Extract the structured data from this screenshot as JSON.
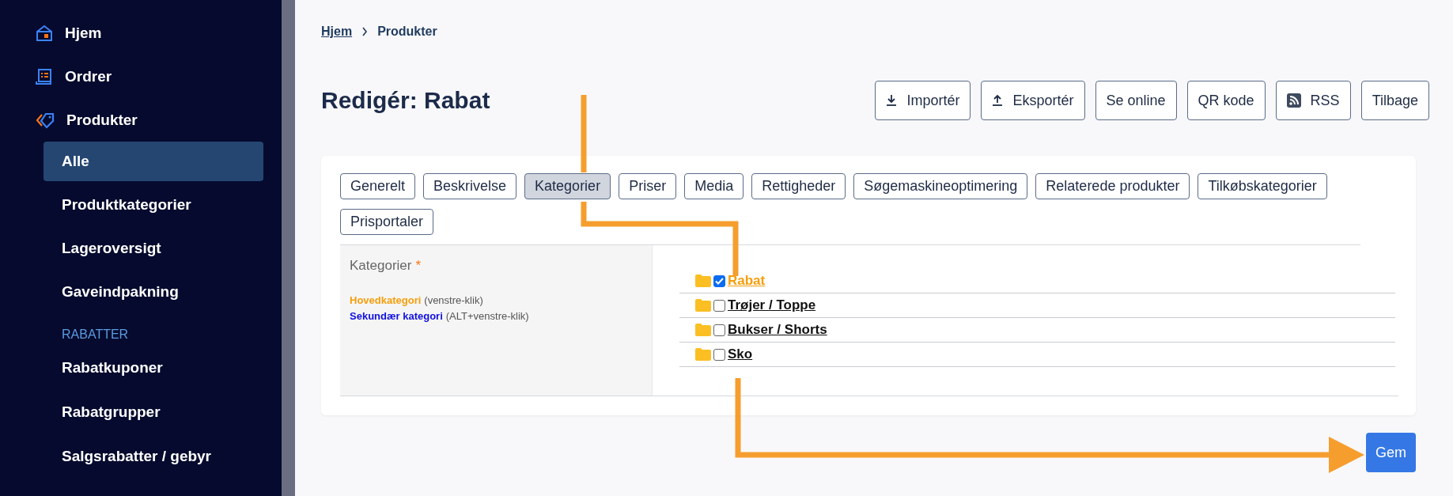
{
  "sidebar": {
    "items": [
      {
        "label": "Hjem"
      },
      {
        "label": "Ordrer"
      },
      {
        "label": "Produkter",
        "children": [
          {
            "label": "Alle",
            "selected": true
          },
          {
            "label": "Produktkategorier",
            "selected": false
          },
          {
            "label": "Lageroversigt",
            "selected": false
          },
          {
            "label": "Gaveindpakning",
            "selected": false
          }
        ]
      }
    ],
    "section": {
      "heading": "RABATTER",
      "items": [
        {
          "label": "Rabatkuponer",
          "selected": false
        },
        {
          "label": "Rabatgrupper",
          "selected": false
        },
        {
          "label": "Salgsrabatter / gebyr",
          "selected": false
        }
      ]
    }
  },
  "breadcrumb": [
    {
      "label": "Hjem",
      "kind": "link"
    },
    {
      "label": "Produkter",
      "kind": "current"
    }
  ],
  "title": "Redigér: Rabat",
  "actions": [
    {
      "label": "Importér"
    },
    {
      "label": "Eksportér"
    },
    {
      "label": "Se online"
    },
    {
      "label": "QR kode"
    },
    {
      "label": "RSS"
    },
    {
      "label": "Tilbage"
    }
  ],
  "tabs": [
    {
      "label": "Generelt",
      "selected": false
    },
    {
      "label": "Beskrivelse",
      "selected": false
    },
    {
      "label": "Kategorier",
      "selected": true
    },
    {
      "label": "Priser",
      "selected": false
    },
    {
      "label": "Media",
      "selected": false
    },
    {
      "label": "Rettigheder",
      "selected": false
    },
    {
      "label": "Søgemaskineoptimering",
      "selected": false
    },
    {
      "label": "Relaterede produkter",
      "selected": false
    },
    {
      "label": "Tilkøbskategorier",
      "selected": false
    },
    {
      "label": "Prisportaler",
      "selected": false
    }
  ],
  "field": {
    "label": "Kategorier",
    "required_mark": "*",
    "legend": [
      {
        "kind": "primary",
        "term": "Hovedkategori",
        "hint": "(venstre-klik)"
      },
      {
        "kind": "secondary",
        "term": "Sekundær kategori",
        "hint": "(ALT+venstre-klik)"
      }
    ]
  },
  "categories": [
    {
      "label": "Rabat",
      "checked": true,
      "primary": true
    },
    {
      "label": "Trøjer / Toppe",
      "checked": false,
      "primary": false
    },
    {
      "label": "Bukser / Shorts",
      "checked": false,
      "primary": false
    },
    {
      "label": "Sko",
      "checked": false,
      "primary": false
    }
  ],
  "save_button": "Gem"
}
